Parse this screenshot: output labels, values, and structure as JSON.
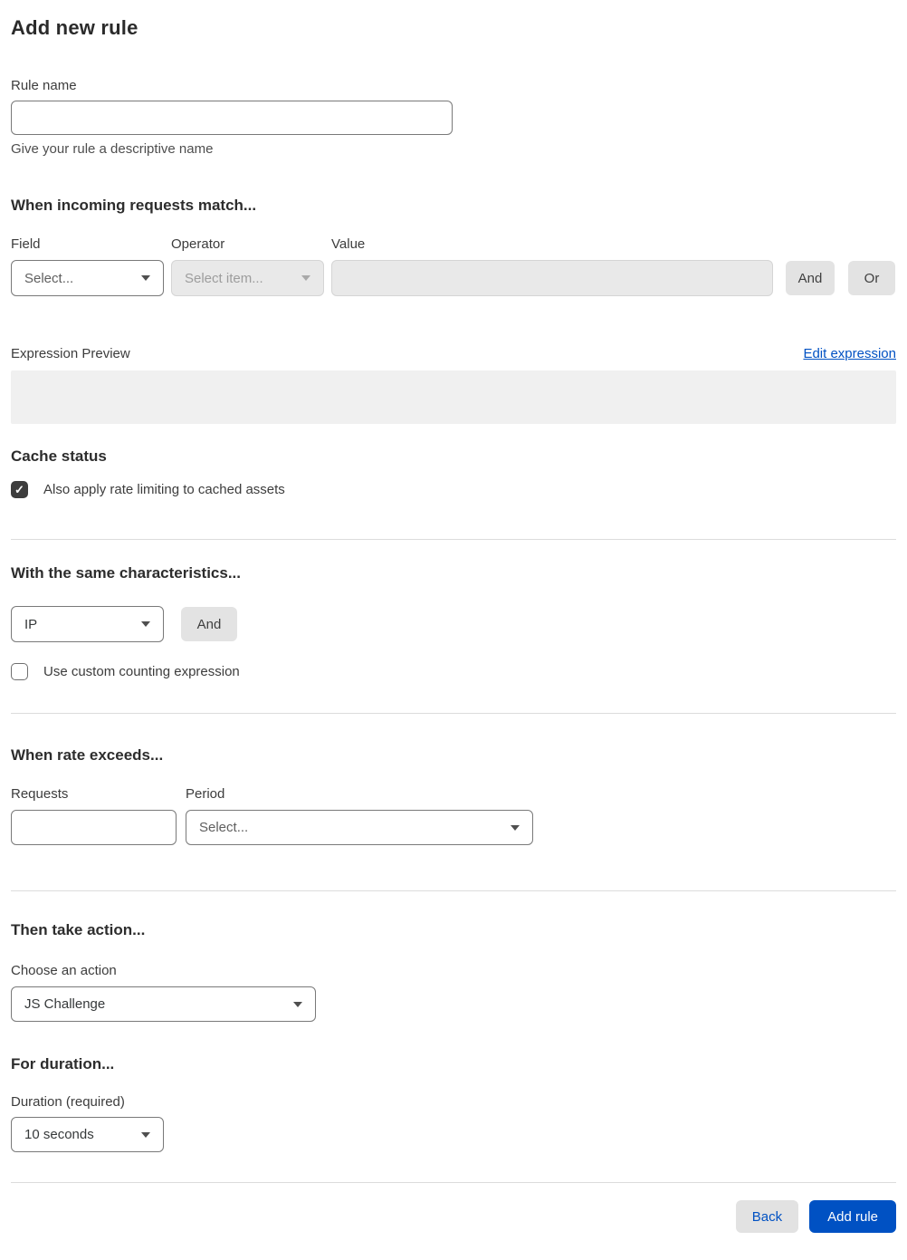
{
  "page": {
    "title": "Add new rule"
  },
  "rule_name": {
    "label": "Rule name",
    "value": "",
    "helper": "Give your rule a descriptive name"
  },
  "match_section": {
    "heading": "When incoming requests match...",
    "field": {
      "label": "Field",
      "selected": "Select..."
    },
    "operator": {
      "label": "Operator",
      "selected": "Select item...",
      "disabled": true
    },
    "value": {
      "label": "Value",
      "value": "",
      "disabled": true
    },
    "and_button": "And",
    "or_button": "Or"
  },
  "expression": {
    "label": "Expression Preview",
    "edit_link": "Edit expression",
    "content": ""
  },
  "cache_status": {
    "heading": "Cache status",
    "checkbox_label": "Also apply rate limiting to cached assets",
    "checked": true
  },
  "characteristics": {
    "heading": "With the same characteristics...",
    "select_selected": "IP",
    "and_button": "And",
    "counting_checkbox_label": "Use custom counting expression",
    "counting_checked": false
  },
  "rate_section": {
    "heading": "When rate exceeds...",
    "requests": {
      "label": "Requests",
      "value": ""
    },
    "period": {
      "label": "Period",
      "selected": "Select..."
    }
  },
  "action_section": {
    "heading": "Then take action...",
    "label": "Choose an action",
    "selected": "JS Challenge"
  },
  "duration_section": {
    "heading": "For duration...",
    "label": "Duration (required)",
    "selected": "10 seconds"
  },
  "footer": {
    "back_label": "Back",
    "add_rule_label": "Add rule"
  },
  "icons": {
    "checkmark": "✓"
  },
  "colors": {
    "accent_blue": "#0051c3",
    "checkbox_checked": "#3d3d3d",
    "disabled_bg": "#e9e9e9",
    "preview_bg": "#f0f0f0",
    "gray_button_bg": "#e3e3e3"
  }
}
